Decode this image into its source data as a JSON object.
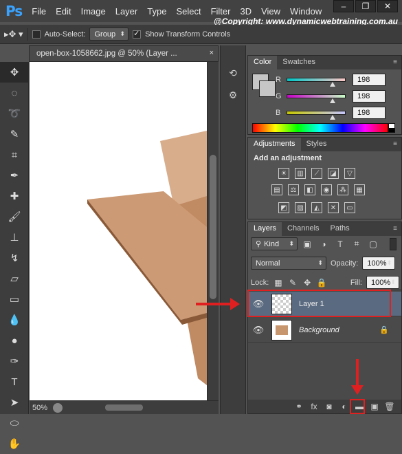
{
  "app": {
    "logo": "Ps"
  },
  "menu": [
    "File",
    "Edit",
    "Image",
    "Layer",
    "Type",
    "Select",
    "Filter",
    "3D",
    "View",
    "Window"
  ],
  "window_buttons": [
    "–",
    "❐",
    "✕"
  ],
  "copyright": "@Copyright: www.dynamicwebtraining.com.au",
  "options": {
    "auto_select_label": "Auto-Select:",
    "auto_select_value": "Group",
    "show_transform_label": "Show Transform Controls"
  },
  "document": {
    "tab_title": "open-box-1058662.jpg @ 50% (Layer ...",
    "close": "×",
    "zoom": "50%"
  },
  "color_panel": {
    "tabs": [
      "Color",
      "Swatches"
    ],
    "r": "198",
    "g": "198",
    "b": "198",
    "r_label": "R",
    "g_label": "G",
    "b_label": "B",
    "swatch_color": "#c6c6c6"
  },
  "adjustments_panel": {
    "tabs": [
      "Adjustments",
      "Styles"
    ],
    "heading": "Add an adjustment"
  },
  "layers_panel": {
    "tabs": [
      "Layers",
      "Channels",
      "Paths"
    ],
    "kind_label": "Kind",
    "blend_mode": "Normal",
    "opacity_label": "Opacity:",
    "opacity_value": "100%",
    "lock_label": "Lock:",
    "fill_label": "Fill:",
    "fill_value": "100%",
    "layers": [
      {
        "name": "Layer 1"
      },
      {
        "name": "Background"
      }
    ]
  },
  "colors": {
    "accent_red": "#e02020",
    "selected_layer": "#5a6a80",
    "box_brown": "#c8966e"
  }
}
